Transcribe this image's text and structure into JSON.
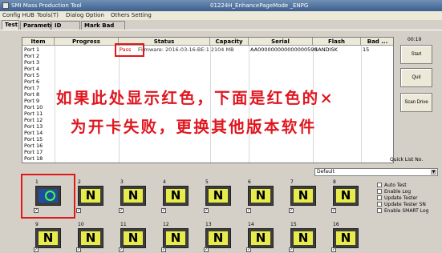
{
  "window": {
    "title": "SMI Mass Production Tool",
    "center_title": "01224H_EnhancePageMode   _ENPG"
  },
  "menu": [
    "Config HUB",
    "Tools(T)",
    "Dialog Option",
    "Others Setting"
  ],
  "tabs": [
    "Test",
    "Parameter",
    "ID Table",
    "Mark Bad Info"
  ],
  "table": {
    "columns": [
      "Item",
      "Progress",
      "Status",
      "Capacity",
      "Serial",
      "Flash",
      "Bad ..."
    ],
    "rows": [
      {
        "port": "Port 1",
        "pass": "Pass",
        "status": "Firmware: 2016-03-16-BE:1 2104 MB",
        "capacity": "",
        "serial": "AA000000000000000590",
        "flash": "SANDISK",
        "bad": "15"
      },
      {
        "port": "Port 2"
      },
      {
        "port": "Port 3"
      },
      {
        "port": "Port 4"
      },
      {
        "port": "Port 5"
      },
      {
        "port": "Port 6"
      },
      {
        "port": "Port 7"
      },
      {
        "port": "Port 8"
      },
      {
        "port": "Port 9"
      },
      {
        "port": "Port 10"
      },
      {
        "port": "Port 11"
      },
      {
        "port": "Port 12"
      },
      {
        "port": "Port 13"
      },
      {
        "port": "Port 14"
      },
      {
        "port": "Port 15"
      },
      {
        "port": "Port 16"
      },
      {
        "port": "Port 17"
      },
      {
        "port": "Port 18"
      }
    ]
  },
  "timer": "00:19",
  "buttons": {
    "start": "Start",
    "quit": "Quit",
    "scan_drive": "Scan Drive"
  },
  "quick_list_label": "Quick List No.",
  "select_value": "Default",
  "options": [
    "Auto Test",
    "Enable Log",
    "Update Tester",
    "Update Tester SN",
    "Enable SMART Log"
  ],
  "overlay": {
    "line1": "如果此处显示红色，下面是红色的×",
    "line2": "为开卡失败，更换其他版本软件"
  },
  "ports": {
    "row1": [
      "1",
      "2",
      "3",
      "4",
      "5",
      "6",
      "7",
      "8"
    ],
    "row2": [
      "9",
      "10",
      "11",
      "12",
      "13",
      "14",
      "15",
      "16"
    ],
    "tile_letter": "N"
  },
  "colors": {
    "accent": "#e01818",
    "pass": "#d40000",
    "tile_yellow": "#e8ec4b",
    "tile_blue": "#1f4d9f"
  }
}
